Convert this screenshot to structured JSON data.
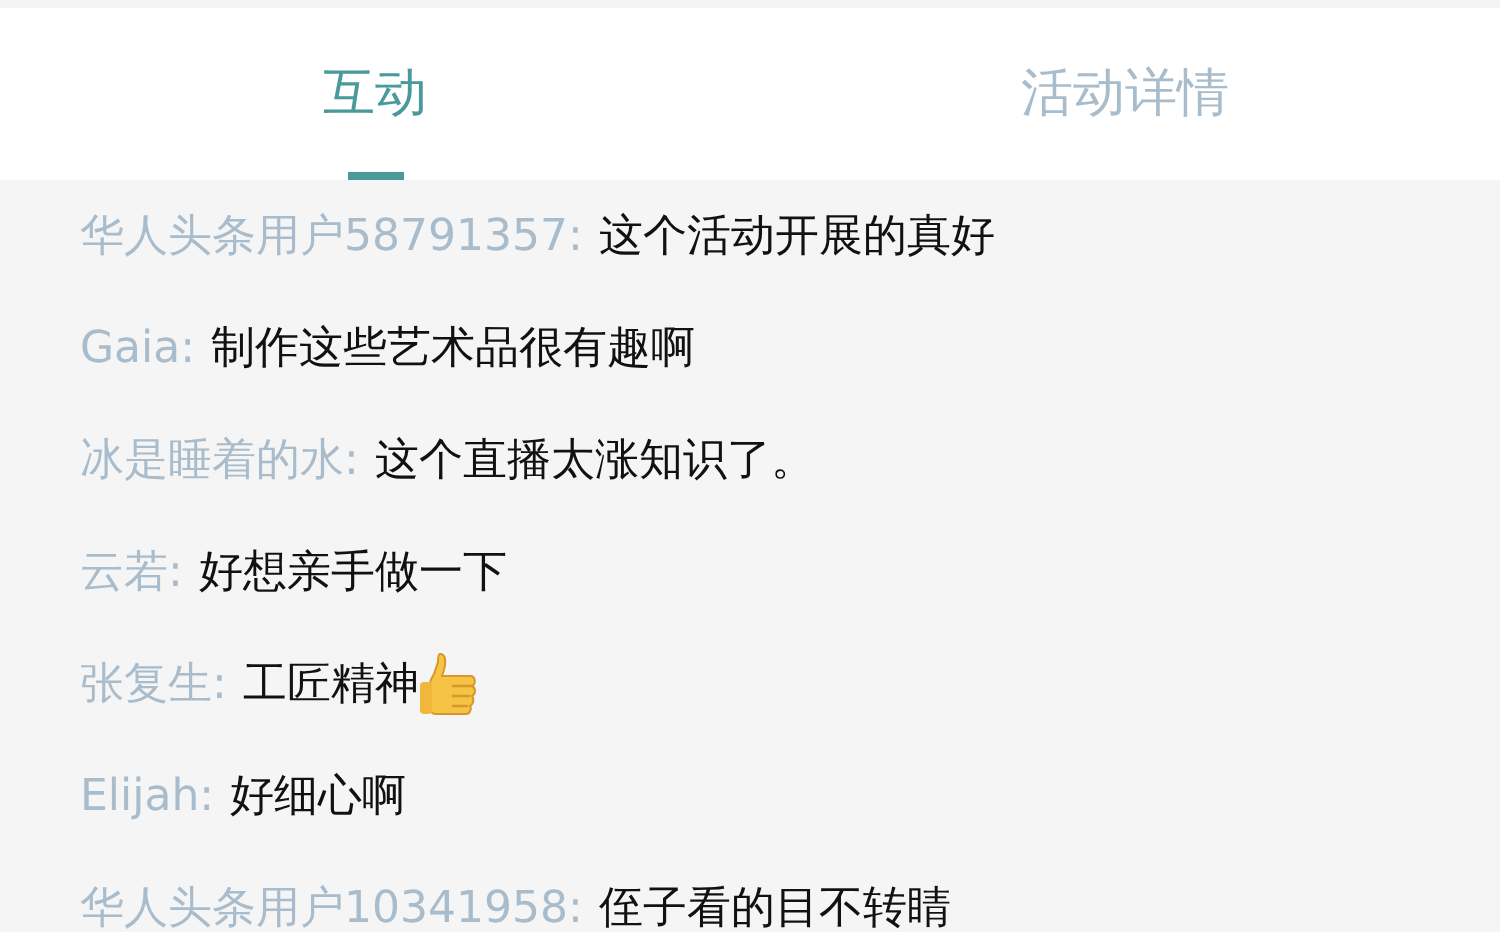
{
  "tabs": [
    {
      "label": "互动",
      "selected": true
    },
    {
      "label": "活动详情",
      "selected": false
    }
  ],
  "comments": [
    {
      "user": "华人头条用户58791357:",
      "text": "这个活动开展的真好",
      "thumbs_up": false
    },
    {
      "user": "Gaia:",
      "text": "制作这些艺术品很有趣啊",
      "thumbs_up": false
    },
    {
      "user": "冰是睡着的水:",
      "text": "这个直播太涨知识了。",
      "thumbs_up": false
    },
    {
      "user": "云若:",
      "text": "好想亲手做一下",
      "thumbs_up": false
    },
    {
      "user": "张复生:",
      "text": "工匠精神",
      "thumbs_up": true
    },
    {
      "user": "Elijah:",
      "text": "好细心啊",
      "thumbs_up": false
    },
    {
      "user": "华人头条用户10341958:",
      "text": "侄子看的目不转睛",
      "thumbs_up": false
    }
  ]
}
